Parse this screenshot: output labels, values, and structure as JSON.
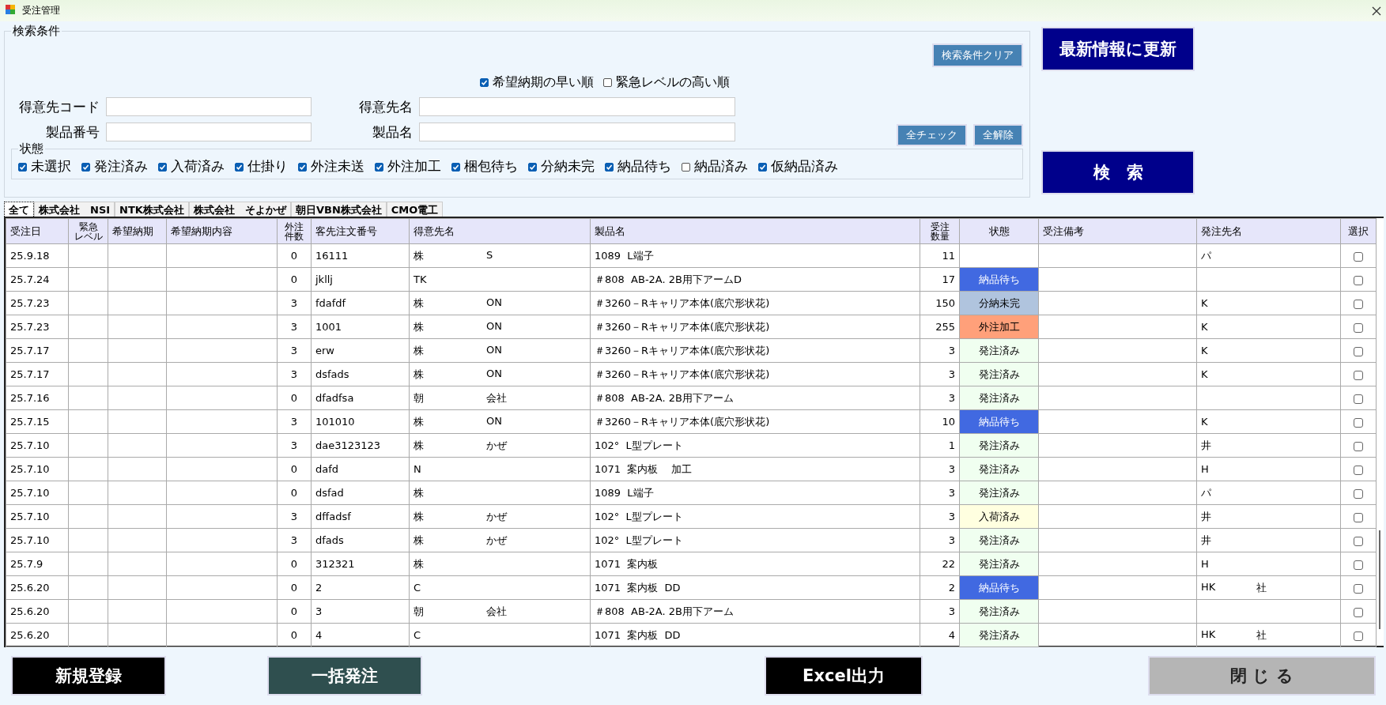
{
  "window": {
    "title": "受注管理"
  },
  "search": {
    "title": "検索条件",
    "clear_button": "検索条件クリア",
    "sort_options": [
      {
        "label": "希望納期の早い順",
        "checked": true
      },
      {
        "label": "緊急レベルの高い順",
        "checked": false
      }
    ],
    "fields": [
      {
        "label": "得意先コード"
      },
      {
        "label": "得意先名"
      },
      {
        "label": "製品番号"
      },
      {
        "label": "製品名"
      }
    ],
    "check_all_button": "全チェック",
    "uncheck_all_button": "全解除",
    "status_group": {
      "title": "状態",
      "options": [
        {
          "label": "未選択",
          "checked": true
        },
        {
          "label": "発注済み",
          "checked": true
        },
        {
          "label": "入荷済み",
          "checked": true
        },
        {
          "label": "仕掛り",
          "checked": true
        },
        {
          "label": "外注未送",
          "checked": true
        },
        {
          "label": "外注加工",
          "checked": true
        },
        {
          "label": "梱包待ち",
          "checked": true
        },
        {
          "label": "分納未完",
          "checked": true
        },
        {
          "label": "納品待ち",
          "checked": true
        },
        {
          "label": "納品済み",
          "checked": false
        },
        {
          "label": "仮納品済み",
          "checked": true
        }
      ]
    }
  },
  "refresh_button": "最新情報に更新",
  "search_button": "検　索",
  "tabs": [
    {
      "label": "全て",
      "selected": true
    },
    {
      "label": "株式会社　NSI",
      "selected": false
    },
    {
      "label": "NTK株式会社",
      "selected": false
    },
    {
      "label": "株式会社　そよかぜ",
      "selected": false
    },
    {
      "label": "朝日VBN株式会社",
      "selected": false
    },
    {
      "label": "CMO電工",
      "selected": false
    }
  ],
  "table": {
    "columns": [
      "受注日",
      [
        "緊急",
        "レベル"
      ],
      "希望納期",
      "希望納期内容",
      [
        "外注",
        "件数"
      ],
      "客先注文番号",
      "得意先名",
      "製品名",
      [
        "受注",
        "数量"
      ],
      "状態",
      "受注備考",
      "発注先名",
      "選択"
    ],
    "rows": [
      {
        "date": "25.9.18",
        "outsourced": "0",
        "order_no": "16111",
        "customer": {
          "head": "株",
          "tail": "S"
        },
        "product": "1089  L端子",
        "quantity": "11",
        "supplier": {
          "head": "パ"
        },
        "selected": false
      },
      {
        "date": "25.7.24",
        "outsourced": "0",
        "order_no": "jkllj",
        "customer": {
          "head": "TK"
        },
        "product": "＃808  AB-2A. 2B用下アームD",
        "quantity": "17",
        "status": {
          "label": "納品待ち",
          "color": "#4169e1"
        },
        "selected": false
      },
      {
        "date": "25.7.23",
        "outsourced": "3",
        "order_no": "fdafdf",
        "customer": {
          "head": "株",
          "tail": "ON"
        },
        "product": "＃3260－Rキャリア本体(底穴形状花)",
        "quantity": "150",
        "status": {
          "label": "分納未完",
          "color": "#b0c4de"
        },
        "supplier": {
          "head": "K"
        },
        "selected": false
      },
      {
        "date": "25.7.23",
        "outsourced": "3",
        "order_no": "1001",
        "customer": {
          "head": "株",
          "tail": "ON"
        },
        "product": "＃3260－Rキャリア本体(底穴形状花)",
        "quantity": "255",
        "status": {
          "label": "外注加工",
          "color": "#ffa07a"
        },
        "supplier": {
          "head": "K"
        },
        "selected": false
      },
      {
        "date": "25.7.17",
        "outsourced": "3",
        "order_no": "erw",
        "customer": {
          "head": "株",
          "tail": "ON"
        },
        "product": "＃3260－Rキャリア本体(底穴形状花)",
        "quantity": "3",
        "status": {
          "label": "発注済み",
          "color": "#f0fff0"
        },
        "supplier": {
          "head": "K"
        },
        "selected": false
      },
      {
        "date": "25.7.17",
        "outsourced": "3",
        "order_no": "dsfads",
        "customer": {
          "head": "株",
          "tail": "ON"
        },
        "product": "＃3260－Rキャリア本体(底穴形状花)",
        "quantity": "3",
        "status": {
          "label": "発注済み",
          "color": "#f0fff0"
        },
        "supplier": {
          "head": "K"
        },
        "selected": false
      },
      {
        "date": "25.7.16",
        "outsourced": "0",
        "order_no": "dfadfsa",
        "customer": {
          "head": "朝",
          "tail": "会社"
        },
        "product": "＃808  AB-2A. 2B用下アーム",
        "quantity": "3",
        "status": {
          "label": "発注済み",
          "color": "#f0fff0"
        },
        "selected": false
      },
      {
        "date": "25.7.15",
        "outsourced": "3",
        "order_no": "101010",
        "customer": {
          "head": "株",
          "tail": "ON"
        },
        "product": "＃3260－Rキャリア本体(底穴形状花)",
        "quantity": "10",
        "status": {
          "label": "納品待ち",
          "color": "#4169e1"
        },
        "supplier": {
          "head": "K"
        },
        "selected": false
      },
      {
        "date": "25.7.10",
        "outsourced": "3",
        "order_no": "dae3123123",
        "customer": {
          "head": "株",
          "tail": "かぜ"
        },
        "product": "102°  L型プレート",
        "quantity": "1",
        "status": {
          "label": "発注済み",
          "color": "#f0fff0"
        },
        "supplier": {
          "head": "井"
        },
        "selected": false
      },
      {
        "date": "25.7.10",
        "outsourced": "0",
        "order_no": "dafd",
        "customer": {
          "head": "N"
        },
        "product": "1071  案内板    加工",
        "quantity": "3",
        "status": {
          "label": "発注済み",
          "color": "#f0fff0"
        },
        "supplier": {
          "head": "H"
        },
        "selected": false
      },
      {
        "date": "25.7.10",
        "outsourced": "0",
        "order_no": "dsfad",
        "customer": {
          "head": "株"
        },
        "product": "1089  L端子",
        "quantity": "3",
        "status": {
          "label": "発注済み",
          "color": "#f0fff0"
        },
        "supplier": {
          "head": "パ"
        },
        "selected": false
      },
      {
        "date": "25.7.10",
        "outsourced": "3",
        "order_no": "dffadsf",
        "customer": {
          "head": "株",
          "tail": "かぜ"
        },
        "product": "102°  L型プレート",
        "quantity": "3",
        "status": {
          "label": "入荷済み",
          "color": "#ffffe0"
        },
        "supplier": {
          "head": "井"
        },
        "selected": false
      },
      {
        "date": "25.7.10",
        "outsourced": "3",
        "order_no": "dfads",
        "customer": {
          "head": "株",
          "tail": "かぜ"
        },
        "product": "102°  L型プレート",
        "quantity": "3",
        "status": {
          "label": "発注済み",
          "color": "#f0fff0"
        },
        "supplier": {
          "head": "井"
        },
        "selected": false
      },
      {
        "date": "25.7.9",
        "outsourced": "0",
        "order_no": "312321",
        "customer": {
          "head": "株"
        },
        "product": "1071  案内板",
        "quantity": "22",
        "status": {
          "label": "発注済み",
          "color": "#f0fff0"
        },
        "supplier": {
          "head": "H"
        },
        "selected": false
      },
      {
        "date": "25.6.20",
        "outsourced": "0",
        "order_no": "2",
        "customer": {
          "head": "C"
        },
        "product": "1071  案内板  DD",
        "quantity": "2",
        "status": {
          "label": "納品待ち",
          "color": "#4169e1"
        },
        "supplier": {
          "head": "HK",
          "tail": "社"
        },
        "selected": false
      },
      {
        "date": "25.6.20",
        "outsourced": "0",
        "order_no": "3",
        "customer": {
          "head": "朝",
          "tail": "会社"
        },
        "product": "＃808  AB-2A. 2B用下アーム",
        "quantity": "3",
        "status": {
          "label": "発注済み",
          "color": "#f0fff0"
        },
        "selected": false
      },
      {
        "date": "25.6.20",
        "outsourced": "0",
        "order_no": "4",
        "customer": {
          "head": "C"
        },
        "product": "1071  案内板  DD",
        "quantity": "4",
        "status": {
          "label": "発注済み",
          "color": "#f0fff0"
        },
        "supplier": {
          "head": "HK",
          "tail": "社"
        },
        "selected": false
      }
    ]
  },
  "footer_buttons": [
    {
      "label": "新規登録",
      "kind": "black"
    },
    {
      "label": "一括発注",
      "kind": "teal"
    },
    {
      "label": "Excel出力",
      "kind": "black"
    },
    {
      "label": "閉 じ る",
      "kind": "grey"
    }
  ]
}
